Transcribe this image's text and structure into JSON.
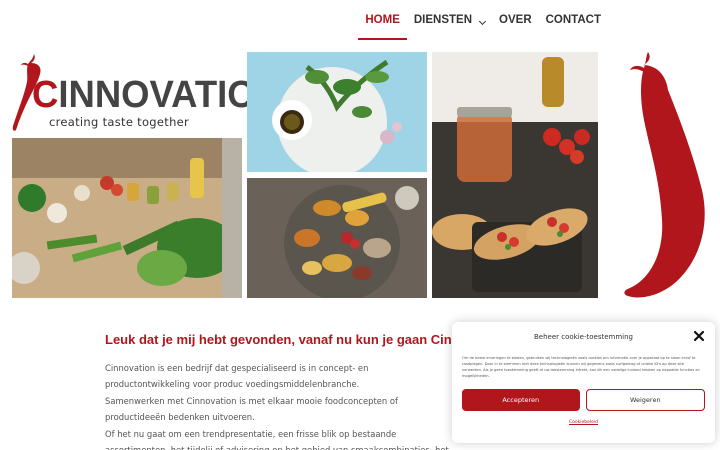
{
  "nav": {
    "items": [
      {
        "label": "HOME",
        "active": true
      },
      {
        "label": "DIENSTEN",
        "active": false,
        "dropdown": true
      },
      {
        "label": "OVER",
        "active": false
      },
      {
        "label": "CONTACT",
        "active": false
      }
    ]
  },
  "logo": {
    "initial": "C",
    "rest": "INNOVATION",
    "tagline": "creating taste together"
  },
  "colors": {
    "brand": "#b1161c",
    "text": "#555555"
  },
  "main": {
    "headline": "Leuk dat je mij hebt gevonden, vanaf nu kun je gaan Cinno",
    "paragraphs": [
      "Cinnovation is een bedrijf dat gespecialiseerd is in concept- en productontwikkeling voor produc voedingsmiddelenbranche.",
      "Samenwerken met Cinnovation is met elkaar mooie foodconcepten of productideeën bedenken uitvoeren.",
      "Of het nu gaat om een trendpresentatie, een frisse blik op bestaande assortimenten, het tijdelij of advisering op het gebied van smaakcombinaties, het behoort allemaal tot de mogelijkheden."
    ]
  },
  "cookie": {
    "title": "Beheer cookie-toestemming",
    "text": "Om de beste ervaringen te bieden, gebruiken wij technologieën zoals cookies om informatie over je apparaat op te slaan en/of te raadplegen. Door in te stemmen met deze technologieën kunnen wij gegevens zoals surfgedrag of unieke ID's op deze site verwerken. Als je geen toestemming geeft of uw toestemming intrekt, kan dit een nadelige invloed hebben op bepaalde functies en mogelijkheden.",
    "accept_label": "Accepteren",
    "decline_label": "Weigeren",
    "policy_label": "Cookiebeleid"
  }
}
